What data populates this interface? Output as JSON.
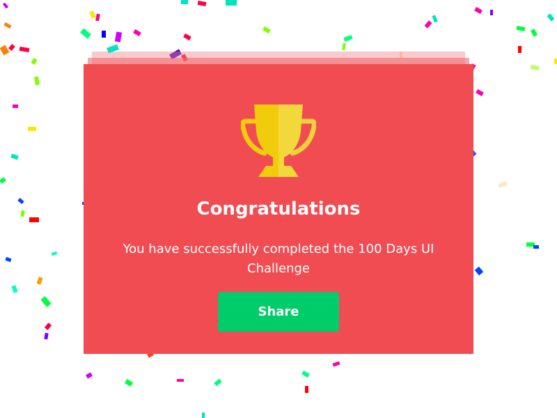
{
  "dialog": {
    "title": "Congratulations",
    "message": "You have successfully completed the 100 Days UI Challenge",
    "share_label": "Share"
  },
  "icons": {
    "trophy": "trophy-icon"
  },
  "colors": {
    "modal_bg": "#f04c52",
    "share_button": "#00cc6a",
    "trophy_gold": "#f1cc0c",
    "text": "#ffffff"
  }
}
